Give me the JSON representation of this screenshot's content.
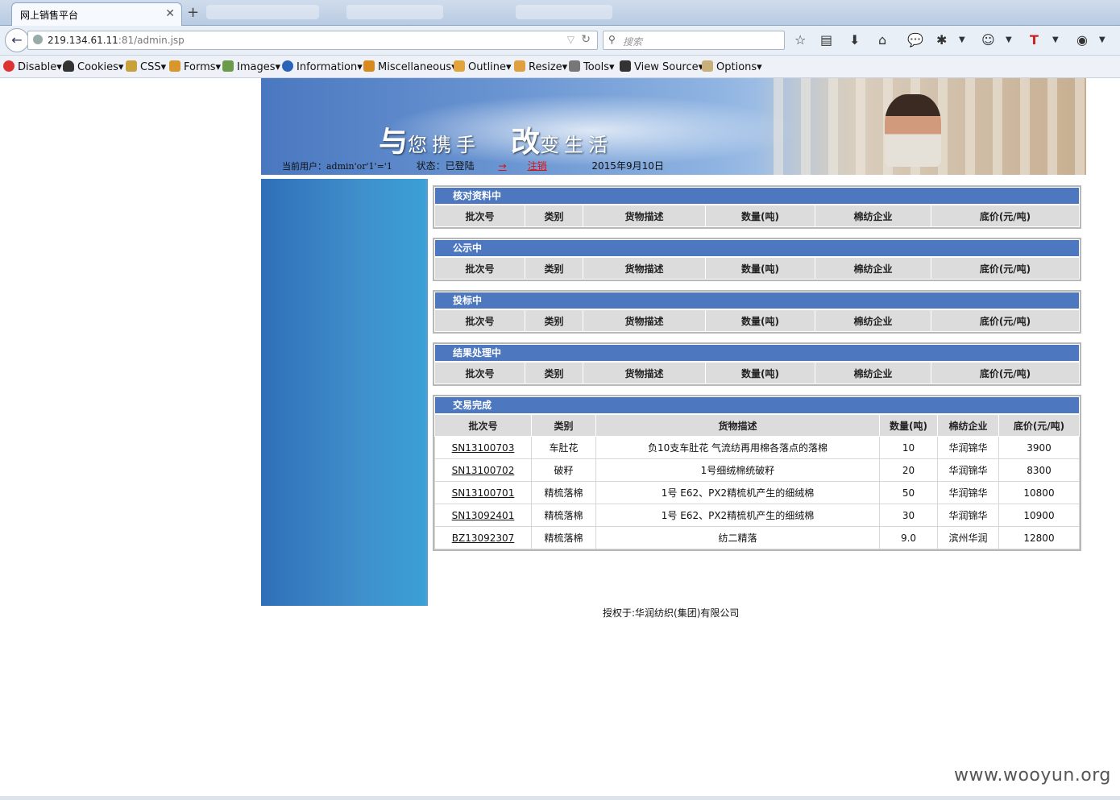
{
  "browser": {
    "tab_title": "网上销售平台",
    "url_host": "219.134.61.11",
    "url_rest": ":81/admin.jsp",
    "search_placeholder": "搜索"
  },
  "devbar": {
    "items": [
      "Disable▾",
      "Cookies▾",
      "CSS▾",
      "Forms▾",
      "Images▾",
      "Information▾",
      "Miscellaneous▾",
      "Outline▾",
      "Resize▾",
      "Tools▾",
      "View Source▾",
      "Options▾"
    ]
  },
  "banner": {
    "slogan_big1": "与",
    "slogan_small1": "您携手",
    "slogan_big2": "改",
    "slogan_small2": "变生活",
    "current_user": "当前用户：admin'or'1'='1",
    "status": "状态：已登陆",
    "logout_arrow": "→",
    "logout": "注销",
    "date": "2015年9月10日"
  },
  "columns": [
    "批次号",
    "类别",
    "货物描述",
    "数量(吨)",
    "棉纺企业",
    "底价(元/吨)"
  ],
  "sections": {
    "checking": "核对资料中",
    "publicity": "公示中",
    "bidding": "投标中",
    "result": "结果处理中",
    "done": "交易完成"
  },
  "done_rows": [
    {
      "batch": "SN13100703",
      "category": "车肚花",
      "desc": "负10支车肚花 气流纺再用棉各落点的落棉",
      "qty": "10",
      "company": "华润锦华",
      "price": "3900"
    },
    {
      "batch": "SN13100702",
      "category": "破籽",
      "desc": "1号细绒棉统破籽",
      "qty": "20",
      "company": "华润锦华",
      "price": "8300"
    },
    {
      "batch": "SN13100701",
      "category": "精梳落棉",
      "desc": "1号 E62、PX2精梳机产生的细绒棉",
      "qty": "50",
      "company": "华润锦华",
      "price": "10800"
    },
    {
      "batch": "SN13092401",
      "category": "精梳落棉",
      "desc": "1号 E62、PX2精梳机产生的细绒棉",
      "qty": "30",
      "company": "华润锦华",
      "price": "10900"
    },
    {
      "batch": "BZ13092307",
      "category": "精梳落棉",
      "desc": "纺二精落",
      "qty": "9.0",
      "company": "滨州华润",
      "price": "12800"
    }
  ],
  "footer": "授权于:华润纺织(集团)有限公司",
  "watermark": "www.wooyun.org"
}
